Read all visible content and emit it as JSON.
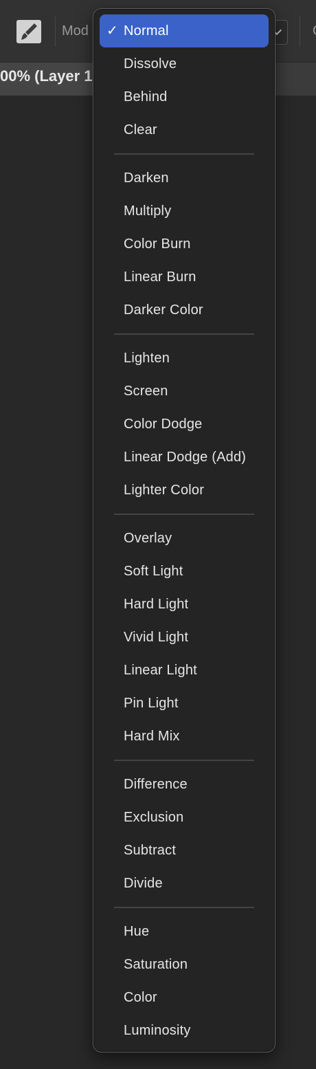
{
  "options_bar": {
    "mode_label": "Mod",
    "opacity_label": "O"
  },
  "document_tab": {
    "label": "00% (Layer 1"
  },
  "blend_menu": {
    "checkmark": "✓",
    "groups": [
      [
        "Normal",
        "Dissolve",
        "Behind",
        "Clear"
      ],
      [
        "Darken",
        "Multiply",
        "Color Burn",
        "Linear Burn",
        "Darker Color"
      ],
      [
        "Lighten",
        "Screen",
        "Color Dodge",
        "Linear Dodge (Add)",
        "Lighter Color"
      ],
      [
        "Overlay",
        "Soft Light",
        "Hard Light",
        "Vivid Light",
        "Linear Light",
        "Pin Light",
        "Hard Mix"
      ],
      [
        "Difference",
        "Exclusion",
        "Subtract",
        "Divide"
      ],
      [
        "Hue",
        "Saturation",
        "Color",
        "Luminosity"
      ]
    ],
    "selected": "Normal"
  },
  "colors": {
    "selection": "#3a62c8",
    "menu_bg": "#242424",
    "canvas_bg": "#282828"
  },
  "icons": {
    "tool": "brush-icon"
  }
}
